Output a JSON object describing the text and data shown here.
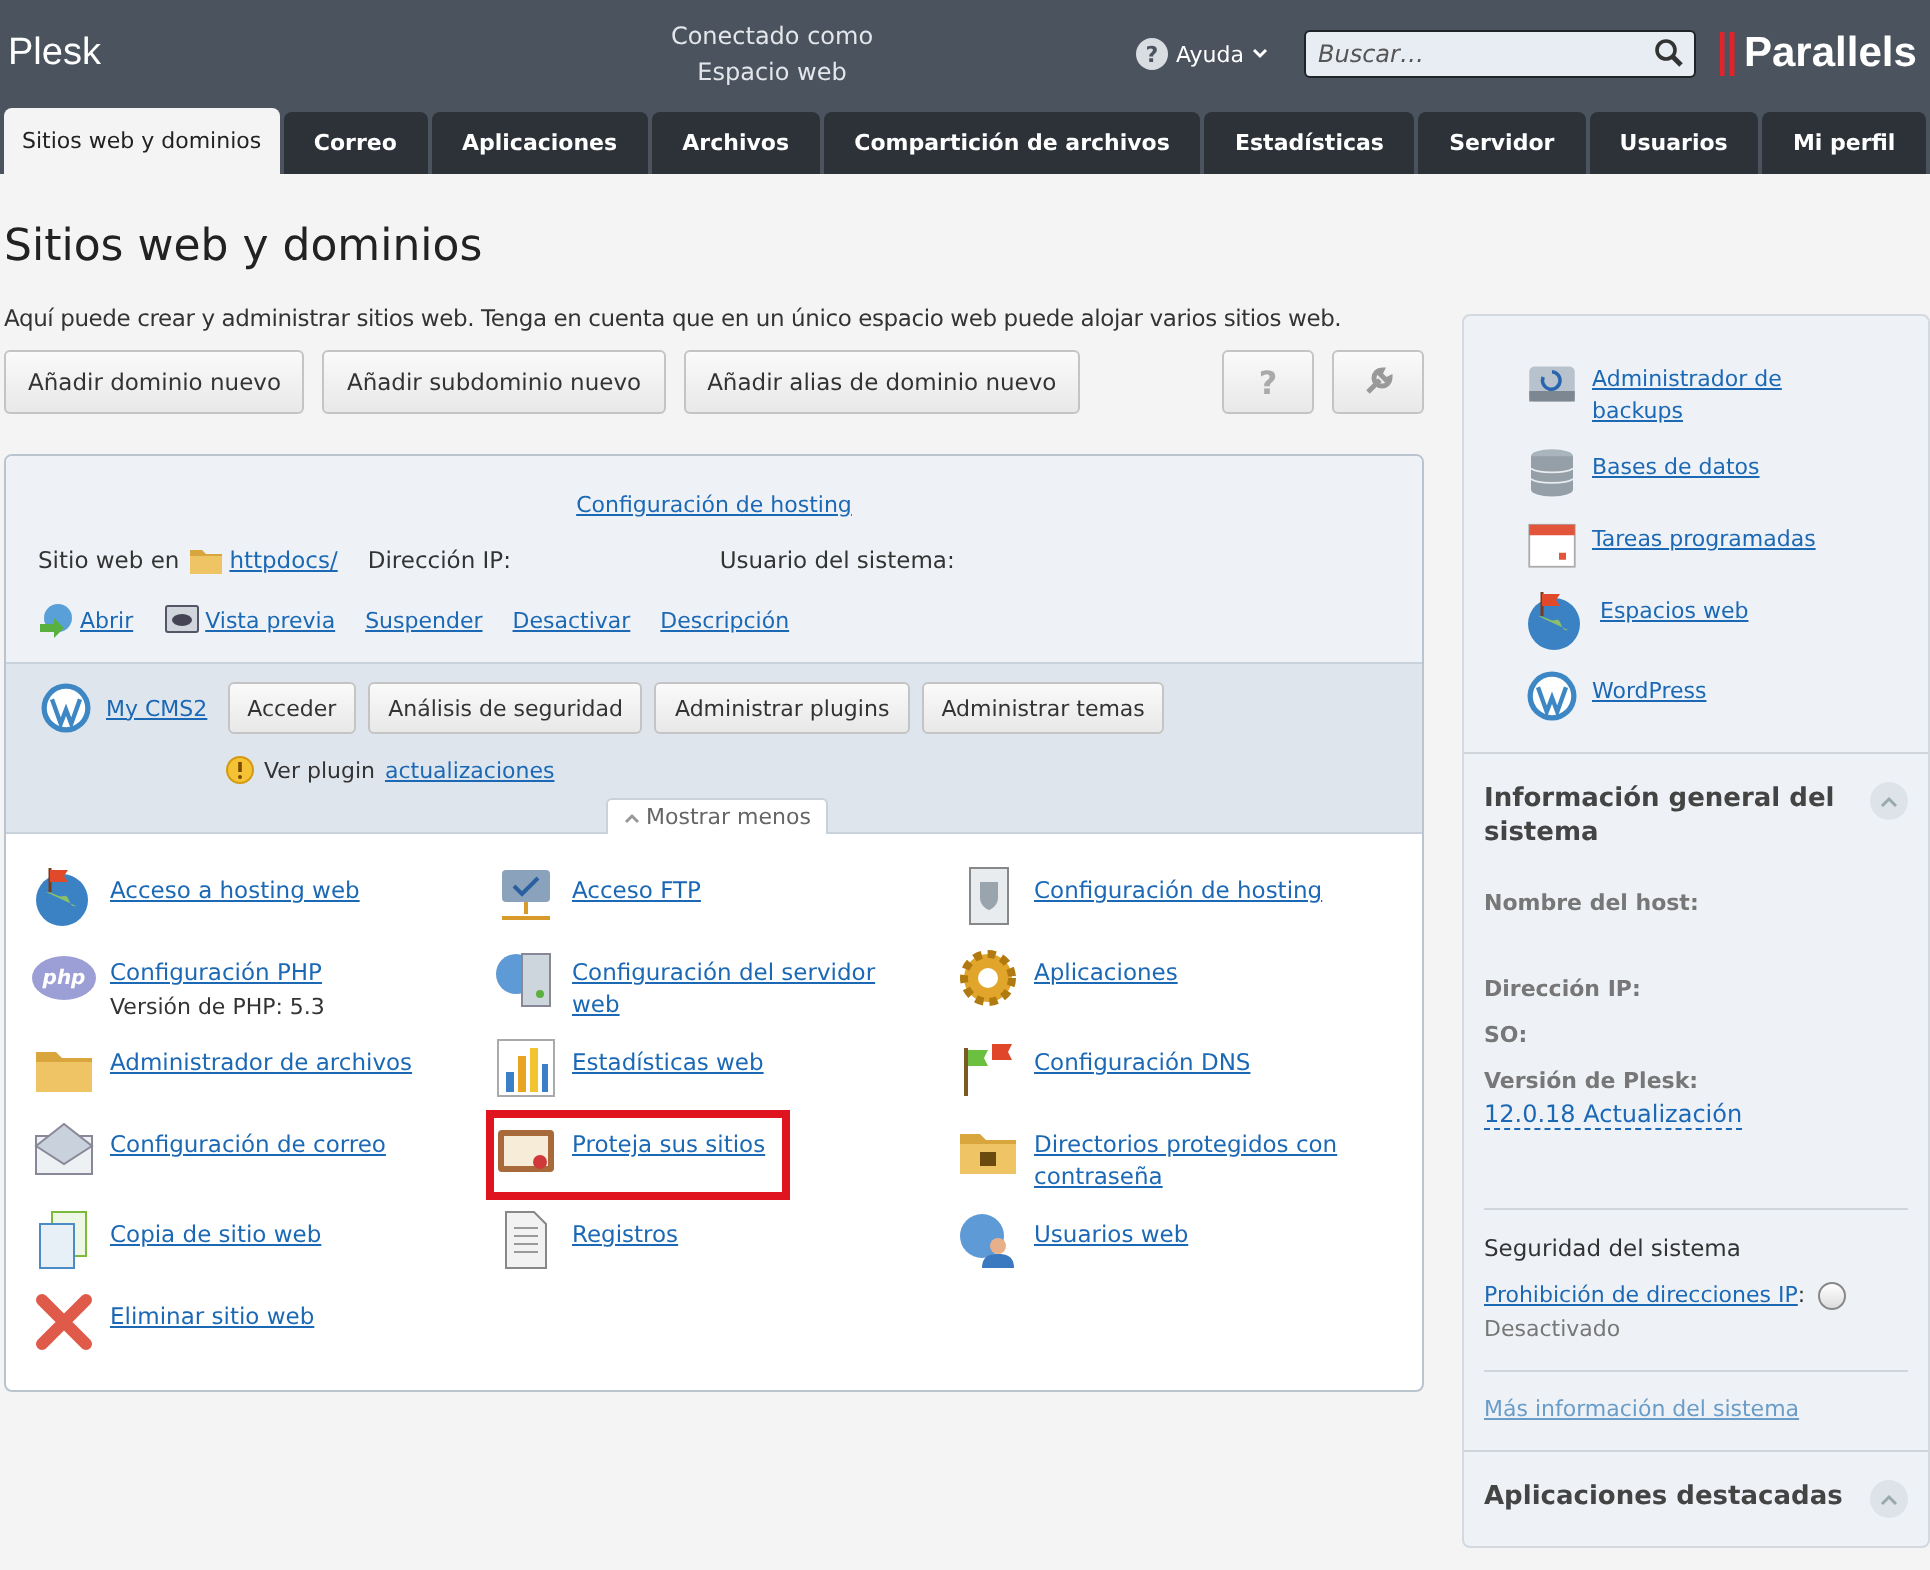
{
  "header": {
    "brand": "Plesk",
    "connected": [
      "Conectado como",
      "Espacio web"
    ],
    "help": "Ayuda",
    "help_icon": "?",
    "search": {
      "placeholder": "Buscar…"
    },
    "logo": "Parallels"
  },
  "tabs": [
    {
      "label": "Sitios web y dominios",
      "selected": true
    },
    {
      "label": "Correo",
      "selected": false
    },
    {
      "label": "Aplicaciones",
      "selected": false
    },
    {
      "label": "Archivos",
      "selected": false
    },
    {
      "label": "Compartición de archivos",
      "selected": false
    },
    {
      "label": "Estadísticas",
      "selected": false
    },
    {
      "label": "Servidor",
      "selected": false
    },
    {
      "label": "Usuarios",
      "selected": false
    },
    {
      "label": "Mi perfil",
      "selected": false
    }
  ],
  "page": {
    "title": "Sitios web y dominios",
    "description": "Aquí puede crear y administrar sitios web. Tenga en cuenta que en un único espacio web puede alojar varios sitios web.",
    "actions": [
      "Añadir dominio nuevo",
      "Añadir subdominio nuevo",
      "Añadir alias de dominio nuevo"
    ],
    "help_button": "?"
  },
  "site": {
    "hosting_link": "Configuración de hosting",
    "location_label": "Sitio web en",
    "folder_link": "httpdocs/",
    "ip_label": "Dirección IP:",
    "user_label": "Usuario del sistema:",
    "links": [
      "Abrir",
      "Vista previa",
      "Suspender",
      "Desactivar",
      "Descripción"
    ],
    "cms": {
      "name": "My CMS2",
      "buttons": [
        "Acceder",
        "Análisis de seguridad",
        "Administrar plugins",
        "Administrar temas"
      ],
      "notice": "Ver plugin",
      "notice_link": "actualizaciones"
    },
    "toggle": {
      "label": "Mostrar menos",
      "expanded": true
    }
  },
  "tools": [
    {
      "label": "Acceso a hosting web",
      "highlighted": false
    },
    {
      "label": "Acceso FTP",
      "highlighted": false
    },
    {
      "label": "Configuración de hosting",
      "highlighted": false
    },
    {
      "label": "Configuración PHP",
      "icon_text": "php",
      "note": "Versión de PHP: 5.3",
      "highlighted": false
    },
    {
      "label": "Configuración del servidor web",
      "highlighted": false
    },
    {
      "label": "Aplicaciones",
      "highlighted": false
    },
    {
      "label": "Administrador de archivos",
      "highlighted": false
    },
    {
      "label": "Estadísticas web",
      "highlighted": false
    },
    {
      "label": "Configuración DNS",
      "highlighted": false
    },
    {
      "label": "Configuración de correo",
      "highlighted": false
    },
    {
      "label": "Proteja sus sitios",
      "highlighted": true
    },
    {
      "label": "Directorios protegidos con contraseña",
      "highlighted": false
    },
    {
      "label": "Copia de sitio web",
      "highlighted": false
    },
    {
      "label": "Registros",
      "highlighted": false
    },
    {
      "label": "Usuarios web",
      "highlighted": false
    },
    {
      "label": "Eliminar sitio web",
      "highlighted": false
    }
  ],
  "sidebar": {
    "links": [
      "Administrador de backups",
      "Bases de datos",
      "Tareas programadas",
      "Espacios web",
      "WordPress"
    ],
    "system_info": {
      "title": "Información general del sistema",
      "expanded": true,
      "host_label": "Nombre del host:",
      "ip_label": "Dirección IP:",
      "os_label": "SO:",
      "version_label": "Versión de Plesk:",
      "version_link": "12.0.18 Actualización"
    },
    "security": {
      "title": "Seguridad del sistema",
      "link": "Prohibición de direcciones IP",
      "separator": ":",
      "status": "Desactivado",
      "on": false
    },
    "more_link": "Más información del sistema",
    "featured": {
      "title": "Aplicaciones destacadas",
      "expanded": true
    }
  }
}
